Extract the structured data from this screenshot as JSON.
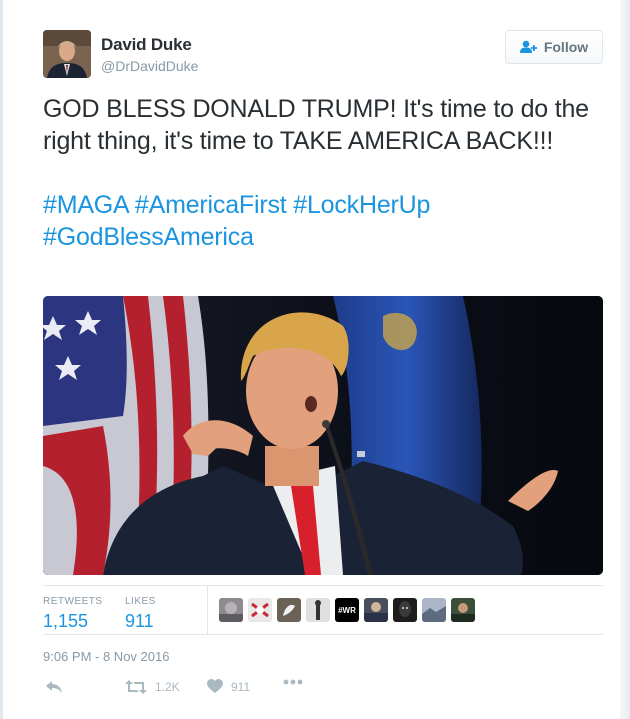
{
  "author": {
    "name": "David Duke",
    "handle": "@DrDavidDuke"
  },
  "follow": {
    "label": "Follow"
  },
  "tweet": {
    "line1": "GOD BLESS DONALD TRUMP! It's time to do the right thing, it's time to TAKE AMERICA BACK!!!",
    "hashtags": [
      "#MAGA",
      "#AmericaFirst",
      "#LockHerUp",
      "#GodBlessAmerica"
    ]
  },
  "stats": {
    "retweets_label": "RETWEETS",
    "retweets_value": "1,155",
    "likes_label": "LIKES",
    "likes_value": "911",
    "likers_count": 10
  },
  "timestamp": "9:06 PM - 8 Nov 2016",
  "actions": {
    "reply_icon": "reply-icon",
    "retweet_icon": "retweet-icon",
    "retweet_count": "1.2K",
    "like_icon": "heart-icon",
    "like_count": "911",
    "more_icon": "more-icon"
  },
  "colors": {
    "link": "#1b95e0",
    "muted": "#8899a6",
    "text": "#292f33",
    "border": "#e1e8ed",
    "action": "#aab8c2"
  }
}
